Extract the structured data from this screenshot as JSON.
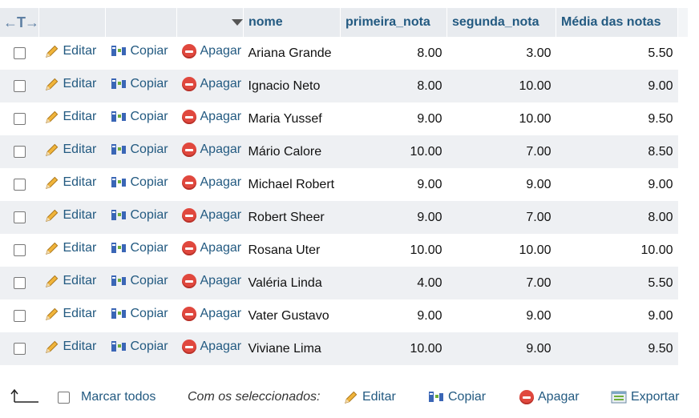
{
  "header": {
    "arrows": "←T→",
    "columns": {
      "nome": "nome",
      "primeira_nota": "primeira_nota",
      "segunda_nota": "segunda_nota",
      "media": "Média das notas"
    }
  },
  "actions": {
    "edit": "Editar",
    "copy": "Copiar",
    "delete": "Apagar"
  },
  "rows": [
    {
      "nome": "Ariana Grande",
      "primeira_nota": "8.00",
      "segunda_nota": "3.00",
      "media": "5.50"
    },
    {
      "nome": "Ignacio Neto",
      "primeira_nota": "8.00",
      "segunda_nota": "10.00",
      "media": "9.00"
    },
    {
      "nome": "Maria Yussef",
      "primeira_nota": "9.00",
      "segunda_nota": "10.00",
      "media": "9.50"
    },
    {
      "nome": "Mário Calore",
      "primeira_nota": "10.00",
      "segunda_nota": "7.00",
      "media": "8.50"
    },
    {
      "nome": "Michael Robert",
      "primeira_nota": "9.00",
      "segunda_nota": "9.00",
      "media": "9.00"
    },
    {
      "nome": "Robert Sheer",
      "primeira_nota": "9.00",
      "segunda_nota": "7.00",
      "media": "8.00"
    },
    {
      "nome": "Rosana Uter",
      "primeira_nota": "10.00",
      "segunda_nota": "10.00",
      "media": "10.00"
    },
    {
      "nome": "Valéria Linda",
      "primeira_nota": "4.00",
      "segunda_nota": "7.00",
      "media": "5.50"
    },
    {
      "nome": "Vater Gustavo",
      "primeira_nota": "9.00",
      "segunda_nota": "9.00",
      "media": "9.00"
    },
    {
      "nome": "Viviane Lima",
      "primeira_nota": "10.00",
      "segunda_nota": "9.00",
      "media": "9.50"
    }
  ],
  "footer": {
    "check_all": "Marcar todos",
    "with_selected": "Com os seleccionados:",
    "edit": "Editar",
    "copy": "Copiar",
    "delete": "Apagar",
    "export": "Exportar"
  },
  "colors": {
    "link": "#235a81",
    "header_bg": "#e8ebef",
    "row_alt_bg": "#eef0f3",
    "delete_icon": "#e0483e"
  }
}
